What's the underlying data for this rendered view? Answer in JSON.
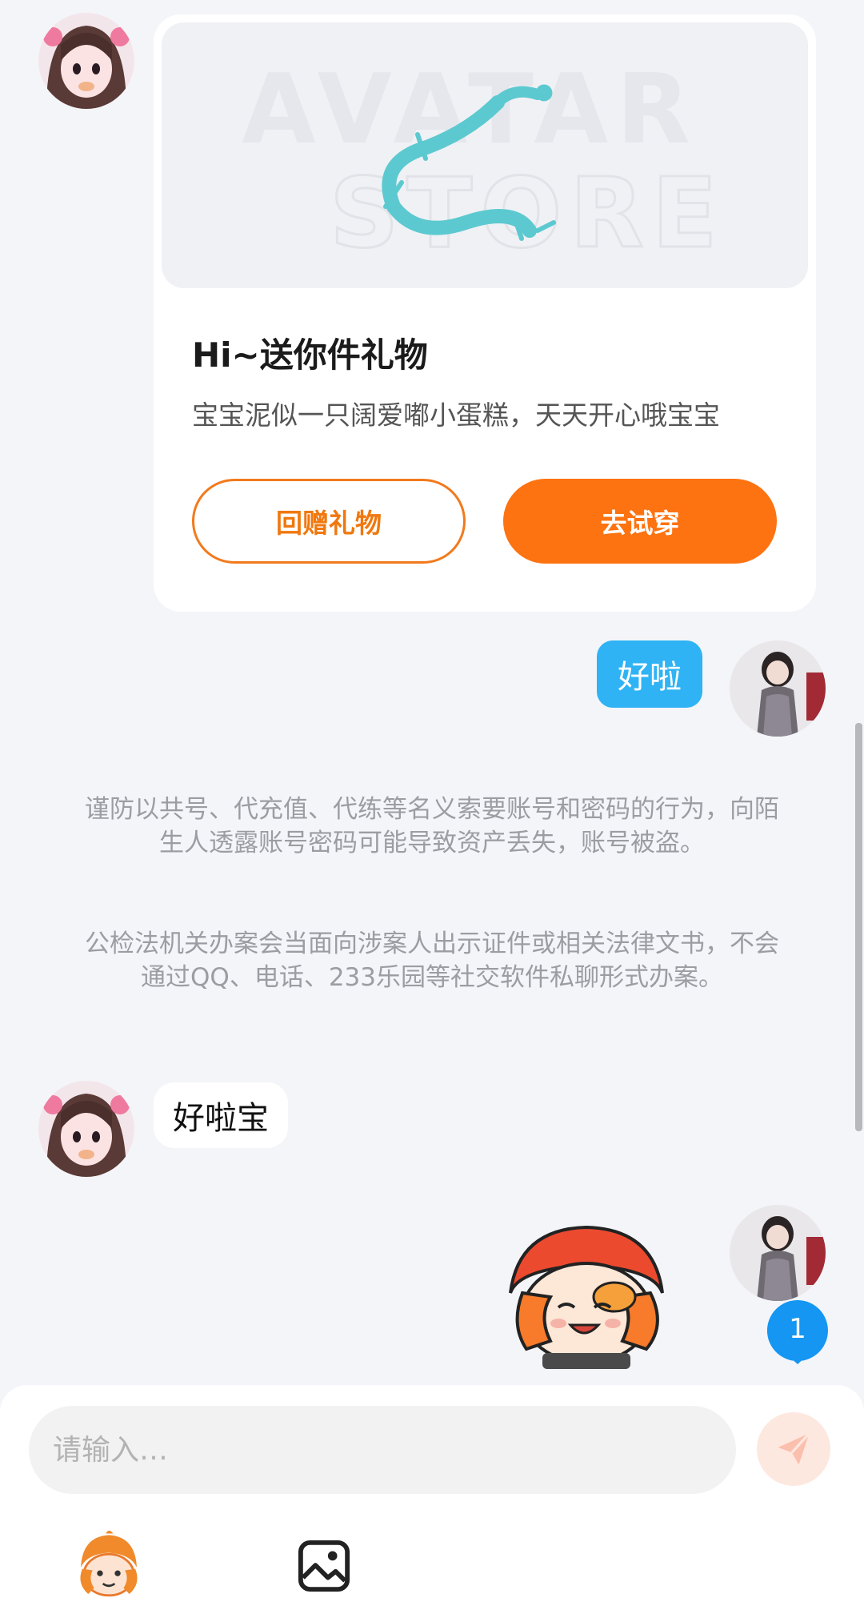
{
  "gift_card": {
    "banner_text_line1": "AVATAR",
    "banner_text_line2": "STORE",
    "title": "Hi~送你件礼物",
    "description": "宝宝泥似一只阔爱嘟小蛋糕，天天开心哦宝宝",
    "return_gift_label": "回赠礼物",
    "try_on_label": "去试穿"
  },
  "messages": {
    "my_reply": "好啦",
    "other_reply": "好啦宝"
  },
  "notices": {
    "account_warning": "谨防以共号、代充值、代练等名义索要账号和密码的行为，向陌生人透露账号密码可能导致资产丢失，账号被盗。",
    "police_warning": "公检法机关办案会当面向涉案人出示证件或相关法律文书，不会通过QQ、电话、233乐园等社交软件私聊形式办案。"
  },
  "unread_badge": "1",
  "composer": {
    "placeholder": "请输入…"
  },
  "icons": {
    "send": "send-icon",
    "emoji": "mascot-emoji-icon",
    "image": "image-icon"
  },
  "colors": {
    "accent_orange": "#fd7311",
    "my_bubble": "#2fb3f4",
    "badge_blue": "#1496f2"
  }
}
